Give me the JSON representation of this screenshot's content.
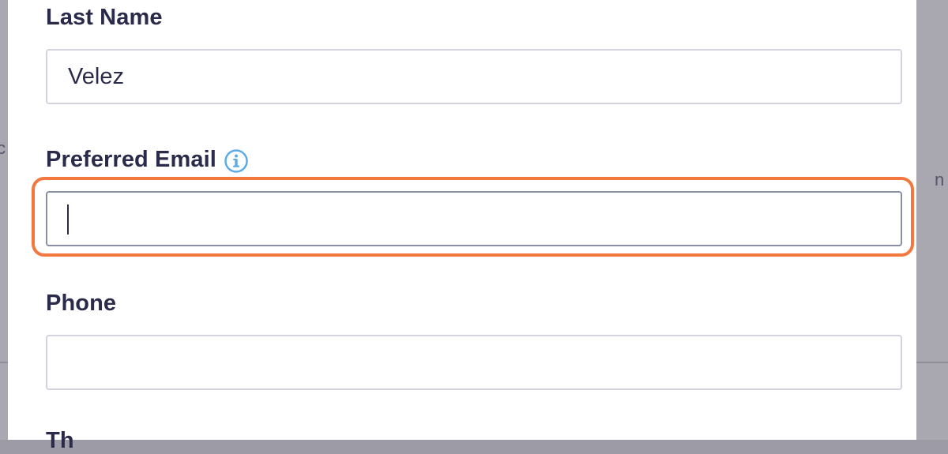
{
  "form": {
    "last_name": {
      "label": "Last Name",
      "value": "Velez",
      "placeholder": ""
    },
    "preferred_email": {
      "label": "Preferred Email",
      "value": "",
      "placeholder": "",
      "info_icon": "info-icon"
    },
    "phone": {
      "label": "Phone",
      "value": "",
      "placeholder": ""
    },
    "next_label_partial": "Th"
  },
  "background": {
    "left_glyph": "c",
    "right_glyph": "n"
  },
  "colors": {
    "focus_ring": "#f3783f",
    "label_text": "#2a2a4a",
    "info_icon": "#5aabe6",
    "overlay": "#9d9ca6"
  }
}
